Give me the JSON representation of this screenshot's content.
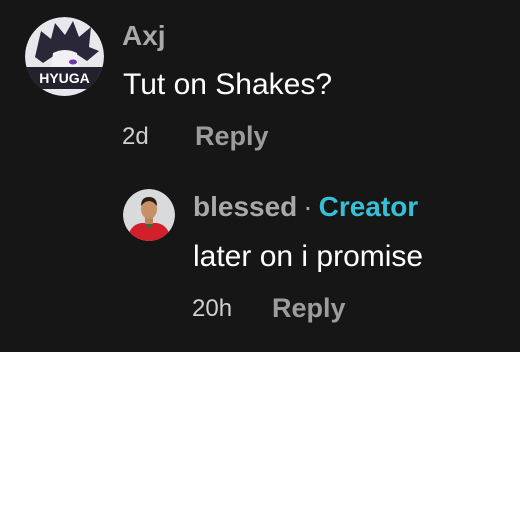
{
  "comment": {
    "username": "Axj",
    "avatar_text": "HYUGA",
    "text": "Tut on Shakes?",
    "time": "2d",
    "reply_label": "Reply"
  },
  "reply": {
    "username": "blessed",
    "separator": "·",
    "badge": "Creator",
    "text": "later on i promise",
    "time": "20h",
    "reply_label": "Reply"
  },
  "colors": {
    "panel_bg": "#161616",
    "username": "#a9a9a9",
    "creator_badge": "#35c0d6",
    "comment_text": "#ffffff",
    "reply_label": "#9c9c9c"
  }
}
